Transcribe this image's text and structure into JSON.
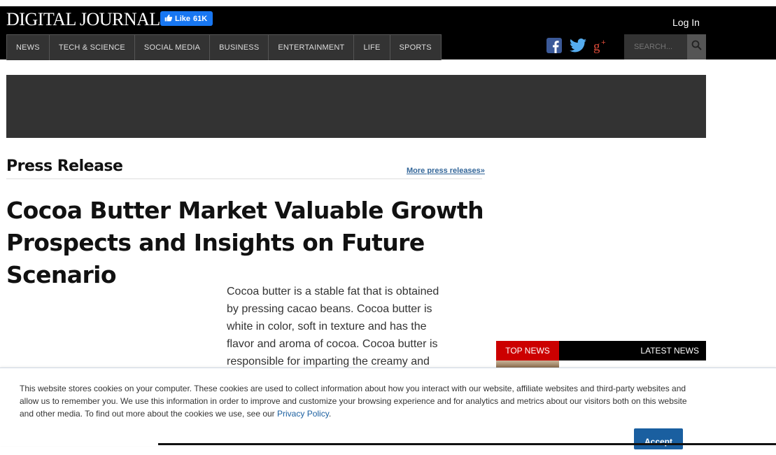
{
  "header": {
    "logo": "DIGITAL JOURNAL",
    "fb_like": "Like",
    "fb_count": "61K",
    "login": "Log In",
    "nav": [
      "NEWS",
      "TECH & SCIENCE",
      "SOCIAL MEDIA",
      "BUSINESS",
      "ENTERTAINMENT",
      "LIFE",
      "SPORTS"
    ],
    "search_placeholder": "SEARCH...",
    "social_icons": [
      "facebook-icon",
      "twitter-icon",
      "google-plus-icon"
    ]
  },
  "section": {
    "title": "Press Release",
    "more_link": "More press releases»"
  },
  "article": {
    "headline": "Cocoa Butter Market Valuable Growth Prospects and Insights on Future Scenario",
    "body": "Cocoa butter is a stable fat that is obtained by pressing cacao beans. Cocoa butter is white in color, soft in texture and has the flavor and aroma of cocoa. Cocoa butter is responsible for imparting the creamy and"
  },
  "sidebar": {
    "tab_top": "TOP NEWS",
    "tab_latest": "LATEST NEWS"
  },
  "cookie": {
    "text": "This website stores cookies on your computer. These cookies are used to collect information about how you interact with our website, affiliate websites and third-party websites and allow us to remember you. We use this information in order to improve and customize your browsing experience and for analytics and metrics about our visitors both on this website and other media. To find out more about the cookies we use, see our",
    "privacy_link": "Privacy Policy",
    "suffix": ".",
    "accept": "Accept"
  },
  "colors": {
    "header_bg": "#000000",
    "nav_bg": "#333333",
    "accent_red": "#cc0000",
    "link_blue": "#336699",
    "fb_blue": "#1877f2"
  }
}
